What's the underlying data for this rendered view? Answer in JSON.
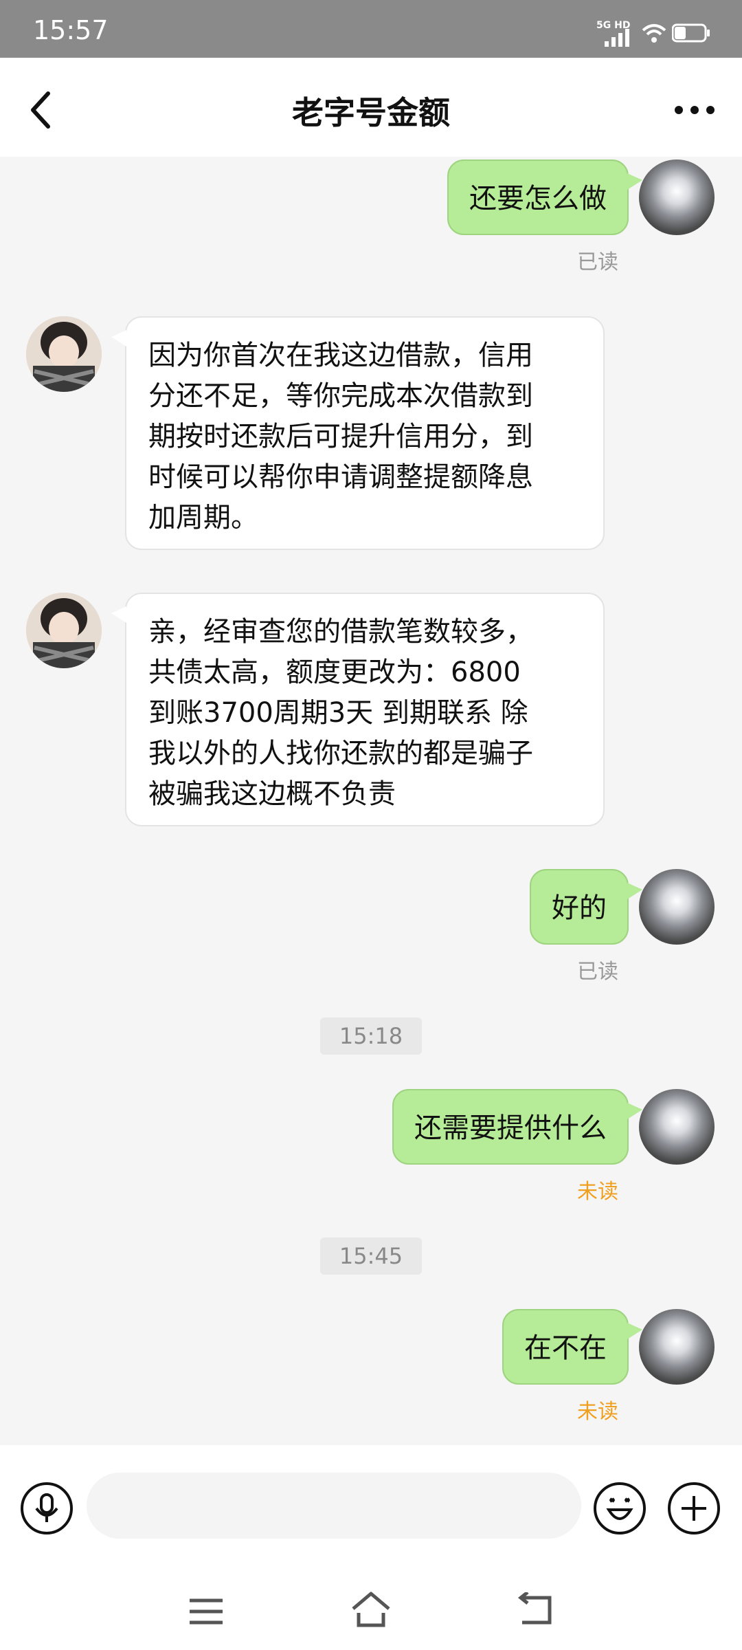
{
  "status_bar": {
    "time": "15:57",
    "network": "5G HD"
  },
  "header": {
    "title": "老字号金额"
  },
  "messages": [
    {
      "from": "me",
      "text": "还要怎么做",
      "status": "已读"
    },
    {
      "from": "other",
      "text": "因为你首次在我这边借款，信用\n分还不足，等你完成本次借款到\n期按时还款后可提升信用分，到\n时候可以帮你申请调整提额降息\n加周期。"
    },
    {
      "from": "other",
      "text": "亲，经审查您的借款笔数较多，\n共债太高，额度更改为：6800\n到账3700周期3天 到期联系 除\n我以外的人找你还款的都是骗子\n被骗我这边概不负责"
    },
    {
      "from": "me",
      "text": "好的",
      "status": "已读"
    },
    {
      "type": "timestamp",
      "text": "15:18"
    },
    {
      "from": "me",
      "text": "还需要提供什么",
      "status": "未读"
    },
    {
      "type": "timestamp",
      "text": "15:45"
    },
    {
      "from": "me",
      "text": "在不在",
      "status": "未读"
    }
  ],
  "input": {
    "placeholder": ""
  },
  "colors": {
    "bubble_me": "#b6eb97",
    "bubble_other": "#ffffff",
    "unread": "#f0a020",
    "read": "#999999"
  }
}
